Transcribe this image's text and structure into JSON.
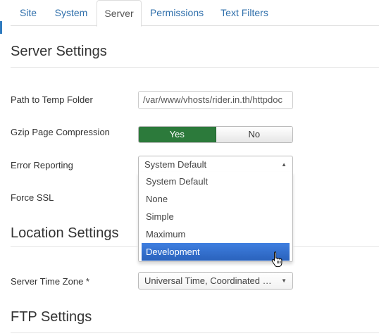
{
  "tabs": [
    {
      "label": "Site"
    },
    {
      "label": "System"
    },
    {
      "label": "Server"
    },
    {
      "label": "Permissions"
    },
    {
      "label": "Text Filters"
    }
  ],
  "active_tab": "Server",
  "server_settings": {
    "title": "Server Settings",
    "temp_path": {
      "label": "Path to Temp Folder",
      "value": "/var/www/vhosts/rider.in.th/httpdoc"
    },
    "gzip": {
      "label": "Gzip Page Compression",
      "yes": "Yes",
      "no": "No",
      "selected": "Yes"
    },
    "error_reporting": {
      "label": "Error Reporting",
      "value": "System Default",
      "options": [
        "System Default",
        "None",
        "Simple",
        "Maximum",
        "Development"
      ],
      "highlighted": "Development"
    },
    "force_ssl": {
      "label": "Force SSL"
    }
  },
  "location_settings": {
    "title": "Location Settings",
    "timezone": {
      "label": "Server Time Zone *",
      "value": "Universal Time, Coordinated …"
    }
  },
  "ftp_settings": {
    "title": "FTP Settings"
  },
  "colors": {
    "accent": "#2f7bbf",
    "toggle_yes": "#2c7a3b",
    "highlight": "#3875d7"
  }
}
